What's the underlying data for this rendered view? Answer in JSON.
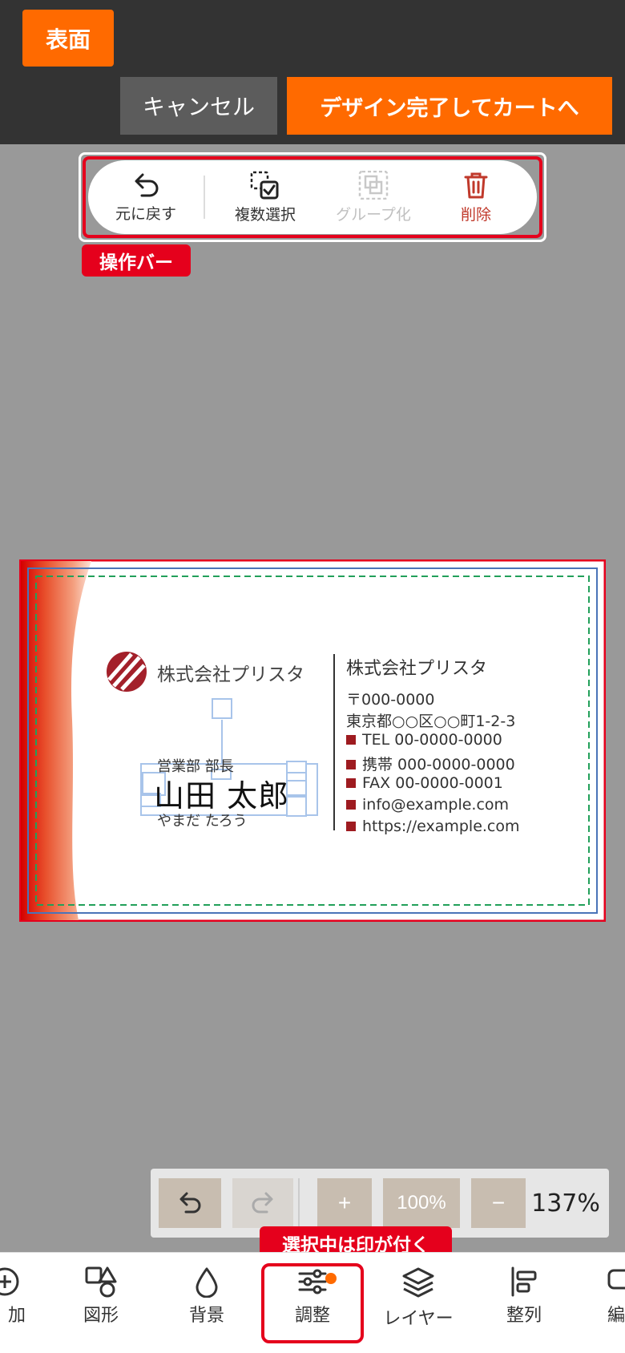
{
  "header": {
    "face_tab": "表面",
    "cancel_label": "キャンセル",
    "finish_label": "デザイン完了してカートへ"
  },
  "operation_bar": {
    "undo": "元に戻す",
    "multi_select": "複数選択",
    "group": "グループ化",
    "delete": "削除",
    "tag": "操作バー"
  },
  "card": {
    "company_left": "株式会社プリスタ",
    "title": "営業部 部長",
    "name": "山田 太郎",
    "kana": "やまだ たろう",
    "company_right": "株式会社プリスタ",
    "postal": "〒000-0000",
    "address": "東京都○○区○○町1-2-3",
    "tel": "TEL 00-0000-0000",
    "mobile": "携帯 000-0000-0000",
    "fax": "FAX 00-0000-0001",
    "email": "info@example.com",
    "url": "https://example.com"
  },
  "zoom": {
    "plus": "+",
    "reset": "100%",
    "minus": "−",
    "level": "137%"
  },
  "selection_tag": "選択中は印が付く",
  "bottom_tools": [
    {
      "label": "加",
      "icon": "add-icon"
    },
    {
      "label": "図形",
      "icon": "shapes-icon"
    },
    {
      "label": "背景",
      "icon": "drop-icon"
    },
    {
      "label": "調整",
      "icon": "sliders-icon"
    },
    {
      "label": "レイヤー",
      "icon": "layers-icon"
    },
    {
      "label": "整列",
      "icon": "align-icon"
    },
    {
      "label": "編",
      "icon": "edit-icon"
    }
  ],
  "colors": {
    "accent": "#ff6a00",
    "highlight_red": "#e5001c",
    "header_bg": "#333333",
    "workspace_bg": "#999999",
    "brand_red": "#9e1b20"
  }
}
